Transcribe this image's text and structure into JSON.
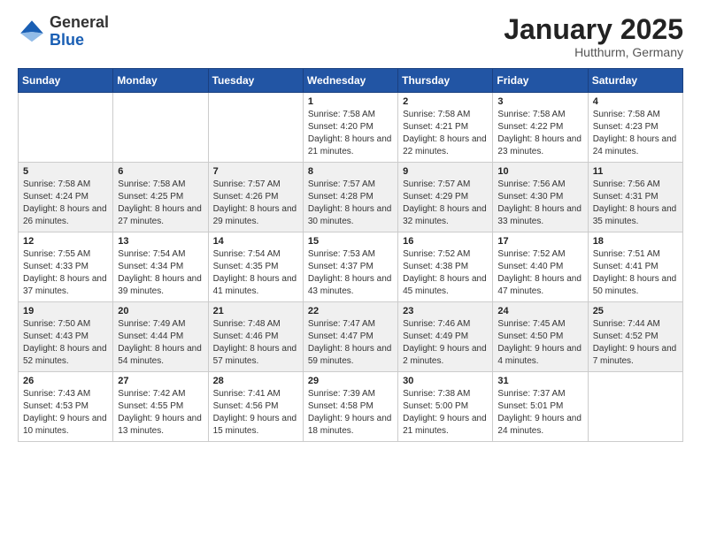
{
  "logo": {
    "general": "General",
    "blue": "Blue"
  },
  "title": "January 2025",
  "location": "Hutthurm, Germany",
  "days_of_week": [
    "Sunday",
    "Monday",
    "Tuesday",
    "Wednesday",
    "Thursday",
    "Friday",
    "Saturday"
  ],
  "weeks": [
    [
      {
        "day": "",
        "info": ""
      },
      {
        "day": "",
        "info": ""
      },
      {
        "day": "",
        "info": ""
      },
      {
        "day": "1",
        "info": "Sunrise: 7:58 AM\nSunset: 4:20 PM\nDaylight: 8 hours and 21 minutes."
      },
      {
        "day": "2",
        "info": "Sunrise: 7:58 AM\nSunset: 4:21 PM\nDaylight: 8 hours and 22 minutes."
      },
      {
        "day": "3",
        "info": "Sunrise: 7:58 AM\nSunset: 4:22 PM\nDaylight: 8 hours and 23 minutes."
      },
      {
        "day": "4",
        "info": "Sunrise: 7:58 AM\nSunset: 4:23 PM\nDaylight: 8 hours and 24 minutes."
      }
    ],
    [
      {
        "day": "5",
        "info": "Sunrise: 7:58 AM\nSunset: 4:24 PM\nDaylight: 8 hours and 26 minutes."
      },
      {
        "day": "6",
        "info": "Sunrise: 7:58 AM\nSunset: 4:25 PM\nDaylight: 8 hours and 27 minutes."
      },
      {
        "day": "7",
        "info": "Sunrise: 7:57 AM\nSunset: 4:26 PM\nDaylight: 8 hours and 29 minutes."
      },
      {
        "day": "8",
        "info": "Sunrise: 7:57 AM\nSunset: 4:28 PM\nDaylight: 8 hours and 30 minutes."
      },
      {
        "day": "9",
        "info": "Sunrise: 7:57 AM\nSunset: 4:29 PM\nDaylight: 8 hours and 32 minutes."
      },
      {
        "day": "10",
        "info": "Sunrise: 7:56 AM\nSunset: 4:30 PM\nDaylight: 8 hours and 33 minutes."
      },
      {
        "day": "11",
        "info": "Sunrise: 7:56 AM\nSunset: 4:31 PM\nDaylight: 8 hours and 35 minutes."
      }
    ],
    [
      {
        "day": "12",
        "info": "Sunrise: 7:55 AM\nSunset: 4:33 PM\nDaylight: 8 hours and 37 minutes."
      },
      {
        "day": "13",
        "info": "Sunrise: 7:54 AM\nSunset: 4:34 PM\nDaylight: 8 hours and 39 minutes."
      },
      {
        "day": "14",
        "info": "Sunrise: 7:54 AM\nSunset: 4:35 PM\nDaylight: 8 hours and 41 minutes."
      },
      {
        "day": "15",
        "info": "Sunrise: 7:53 AM\nSunset: 4:37 PM\nDaylight: 8 hours and 43 minutes."
      },
      {
        "day": "16",
        "info": "Sunrise: 7:52 AM\nSunset: 4:38 PM\nDaylight: 8 hours and 45 minutes."
      },
      {
        "day": "17",
        "info": "Sunrise: 7:52 AM\nSunset: 4:40 PM\nDaylight: 8 hours and 47 minutes."
      },
      {
        "day": "18",
        "info": "Sunrise: 7:51 AM\nSunset: 4:41 PM\nDaylight: 8 hours and 50 minutes."
      }
    ],
    [
      {
        "day": "19",
        "info": "Sunrise: 7:50 AM\nSunset: 4:43 PM\nDaylight: 8 hours and 52 minutes."
      },
      {
        "day": "20",
        "info": "Sunrise: 7:49 AM\nSunset: 4:44 PM\nDaylight: 8 hours and 54 minutes."
      },
      {
        "day": "21",
        "info": "Sunrise: 7:48 AM\nSunset: 4:46 PM\nDaylight: 8 hours and 57 minutes."
      },
      {
        "day": "22",
        "info": "Sunrise: 7:47 AM\nSunset: 4:47 PM\nDaylight: 8 hours and 59 minutes."
      },
      {
        "day": "23",
        "info": "Sunrise: 7:46 AM\nSunset: 4:49 PM\nDaylight: 9 hours and 2 minutes."
      },
      {
        "day": "24",
        "info": "Sunrise: 7:45 AM\nSunset: 4:50 PM\nDaylight: 9 hours and 4 minutes."
      },
      {
        "day": "25",
        "info": "Sunrise: 7:44 AM\nSunset: 4:52 PM\nDaylight: 9 hours and 7 minutes."
      }
    ],
    [
      {
        "day": "26",
        "info": "Sunrise: 7:43 AM\nSunset: 4:53 PM\nDaylight: 9 hours and 10 minutes."
      },
      {
        "day": "27",
        "info": "Sunrise: 7:42 AM\nSunset: 4:55 PM\nDaylight: 9 hours and 13 minutes."
      },
      {
        "day": "28",
        "info": "Sunrise: 7:41 AM\nSunset: 4:56 PM\nDaylight: 9 hours and 15 minutes."
      },
      {
        "day": "29",
        "info": "Sunrise: 7:39 AM\nSunset: 4:58 PM\nDaylight: 9 hours and 18 minutes."
      },
      {
        "day": "30",
        "info": "Sunrise: 7:38 AM\nSunset: 5:00 PM\nDaylight: 9 hours and 21 minutes."
      },
      {
        "day": "31",
        "info": "Sunrise: 7:37 AM\nSunset: 5:01 PM\nDaylight: 9 hours and 24 minutes."
      },
      {
        "day": "",
        "info": ""
      }
    ]
  ]
}
